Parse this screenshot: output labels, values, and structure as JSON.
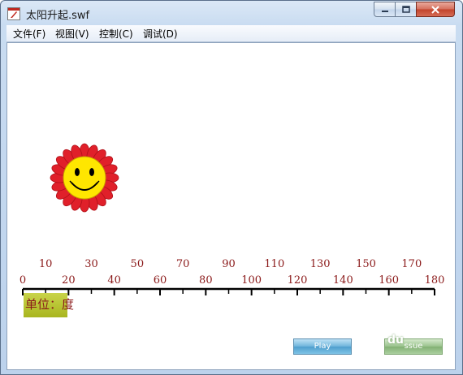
{
  "window": {
    "title": "太阳升起.swf",
    "controls": {
      "minimize": "minimize",
      "maximize": "maximize",
      "close": "close"
    }
  },
  "menu": {
    "items": [
      {
        "label": "文件(F)"
      },
      {
        "label": "视图(V)"
      },
      {
        "label": "控制(C)"
      },
      {
        "label": "调试(D)"
      }
    ]
  },
  "ruler": {
    "upper_labels": [
      "10",
      "30",
      "50",
      "70",
      "90",
      "110",
      "130",
      "150",
      "170"
    ],
    "lower_labels": [
      "0",
      "20",
      "40",
      "60",
      "80",
      "100",
      "120",
      "140",
      "160",
      "180"
    ],
    "min": 0,
    "max": 180,
    "label_color": "#8b1a1a"
  },
  "sun": {
    "icon": "smiling-sun-icon",
    "face_color": "#ffe600",
    "petal_color": "#e0202a"
  },
  "unit": {
    "label": "单位：度"
  },
  "buttons": {
    "play_label": "Play",
    "second_label": "ssue"
  },
  "watermark": {
    "mark": "du"
  }
}
